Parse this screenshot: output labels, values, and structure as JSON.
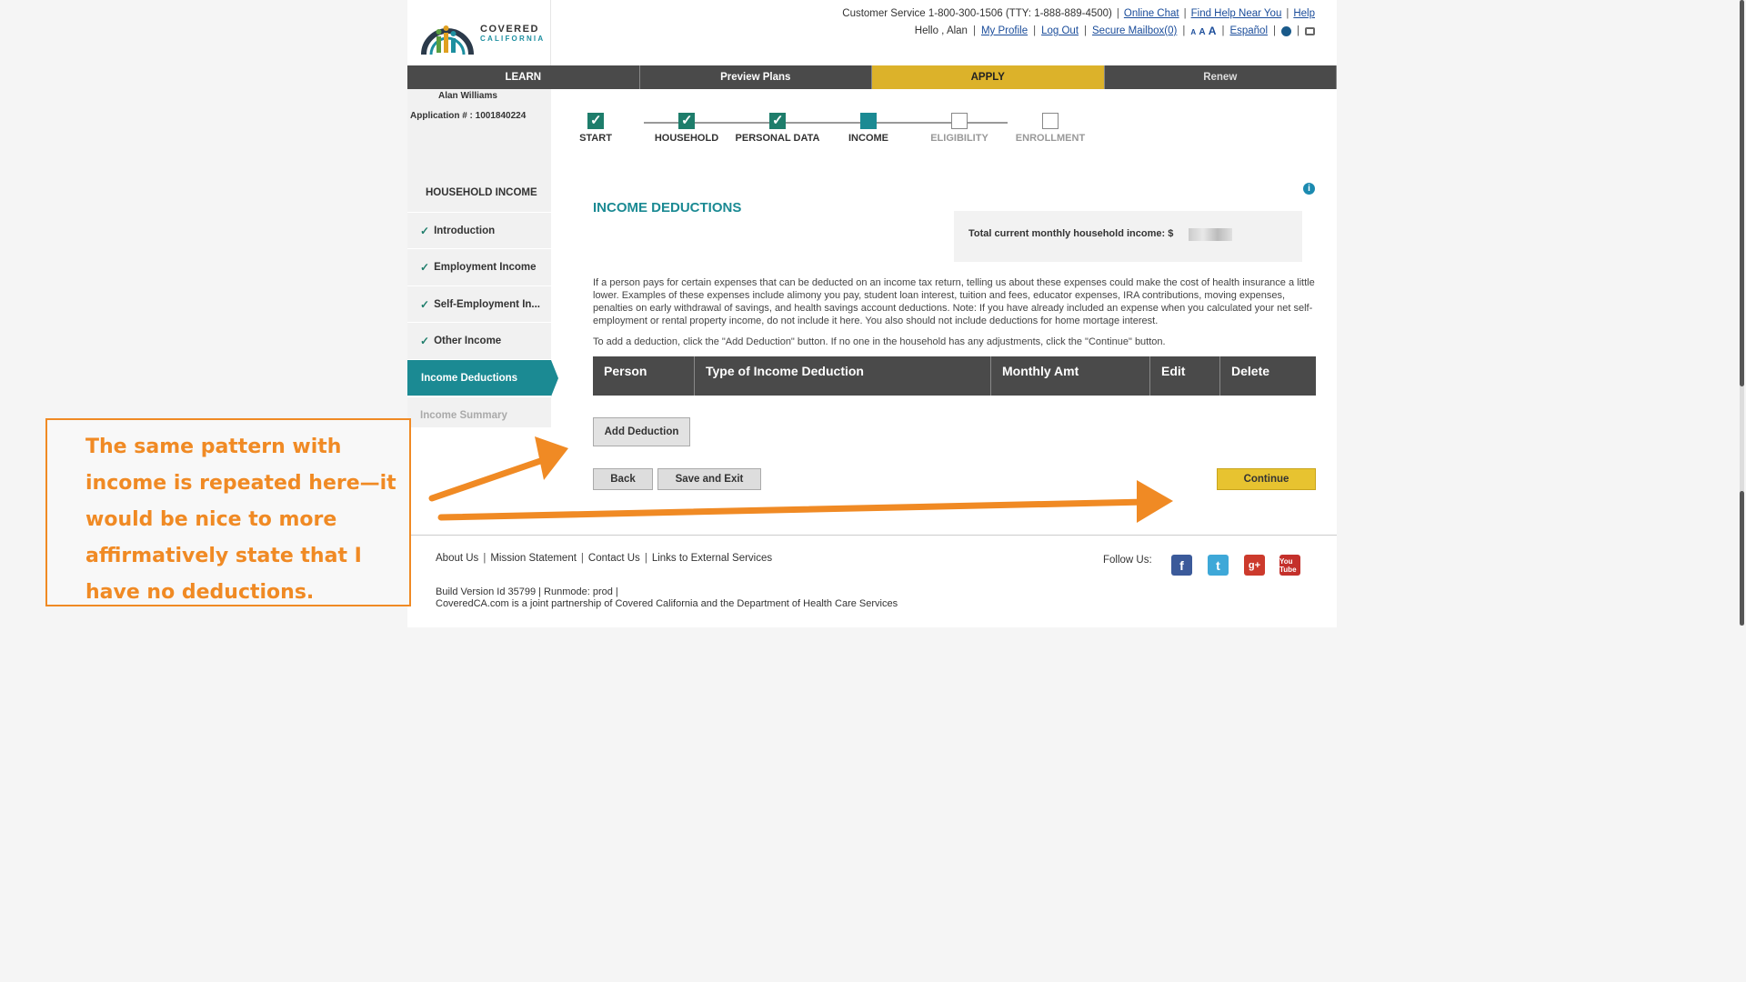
{
  "header": {
    "brand_line1": "COVERED",
    "brand_line2": "CALIFORNIA",
    "customer_service": "Customer Service 1-800-300-1506 (TTY: 1-888-889-4500)",
    "online_chat": "Online Chat",
    "find_help": "Find Help Near You",
    "help": "Help",
    "greeting": "Hello , Alan",
    "my_profile": "My Profile",
    "log_out": "Log Out",
    "secure_mailbox": "Secure Mailbox(0)",
    "font_sizes": [
      "A",
      "A",
      "A"
    ],
    "espanol": "Español"
  },
  "nav": {
    "tabs": [
      {
        "label": "LEARN"
      },
      {
        "label": "Preview Plans"
      },
      {
        "label": "APPLY"
      },
      {
        "label": "Renew"
      }
    ],
    "active_color": "#dcb22a"
  },
  "sidebar": {
    "user_name": "Alan Williams",
    "application_number": "Application # : 1001840224",
    "heading": "HOUSEHOLD INCOME",
    "items": [
      {
        "label": "Introduction",
        "check": "✓"
      },
      {
        "label": "Employment Income",
        "check": "✓"
      },
      {
        "label": "Self-Employment In...",
        "check": "✓"
      },
      {
        "label": "Other Income",
        "check": "✓"
      },
      {
        "label": "Income Deductions",
        "check": ""
      },
      {
        "label": "Income Summary",
        "check": ""
      }
    ]
  },
  "progress": {
    "steps": [
      {
        "label": "START",
        "state": "done"
      },
      {
        "label": "HOUSEHOLD",
        "state": "done"
      },
      {
        "label": "PERSONAL DATA",
        "state": "done"
      },
      {
        "label": "INCOME",
        "state": "current"
      },
      {
        "label": "ELIGIBILITY",
        "state": "future"
      },
      {
        "label": "ENROLLMENT",
        "state": "future"
      }
    ]
  },
  "main": {
    "info_icon": "i",
    "title": "INCOME DEDUCTIONS",
    "total_income_label": "Total current monthly household income: $",
    "description": "If a person pays for certain expenses that can be deducted on an income tax return, telling us about these expenses could make the cost of health insurance a little lower. Examples of these expenses include alimony you pay, student loan interest, tuition and fees, educator expenses, IRA contributions, moving expenses, penalties on early withdrawal of savings, and health savings account deductions. Note: If you have already included an expense when you calculated your net self-employment or rental property income, do not include it here. You also should not include deductions for home mortage interest.",
    "hint": "To add a deduction, click the \"Add Deduction\" button. If no one in the household has any adjustments, click the \"Continue\" button.",
    "table_headers": [
      "Person",
      "Type of Income Deduction",
      "Monthly Amt",
      "Edit",
      "Delete"
    ],
    "add_deduction": "Add Deduction",
    "back": "Back",
    "save_exit": "Save and Exit",
    "continue": "Continue"
  },
  "footer": {
    "links": [
      "About Us",
      "Mission Statement",
      "Contact Us",
      "Links to External Services"
    ],
    "build": "Build Version Id 35799  |   Runmode: prod  |",
    "partnership": "CoveredCA.com is a joint partnership of Covered California and the Department of Health Care Services",
    "follow_us": "Follow Us:",
    "social": {
      "facebook": "f",
      "twitter": "t",
      "googleplus": "g+",
      "youtube": "You Tube"
    }
  },
  "annotation": {
    "text": "The same pattern with income is repeated here—it would be nice to more affirmatively state that I have no deductions.",
    "color": "#f08a24"
  }
}
